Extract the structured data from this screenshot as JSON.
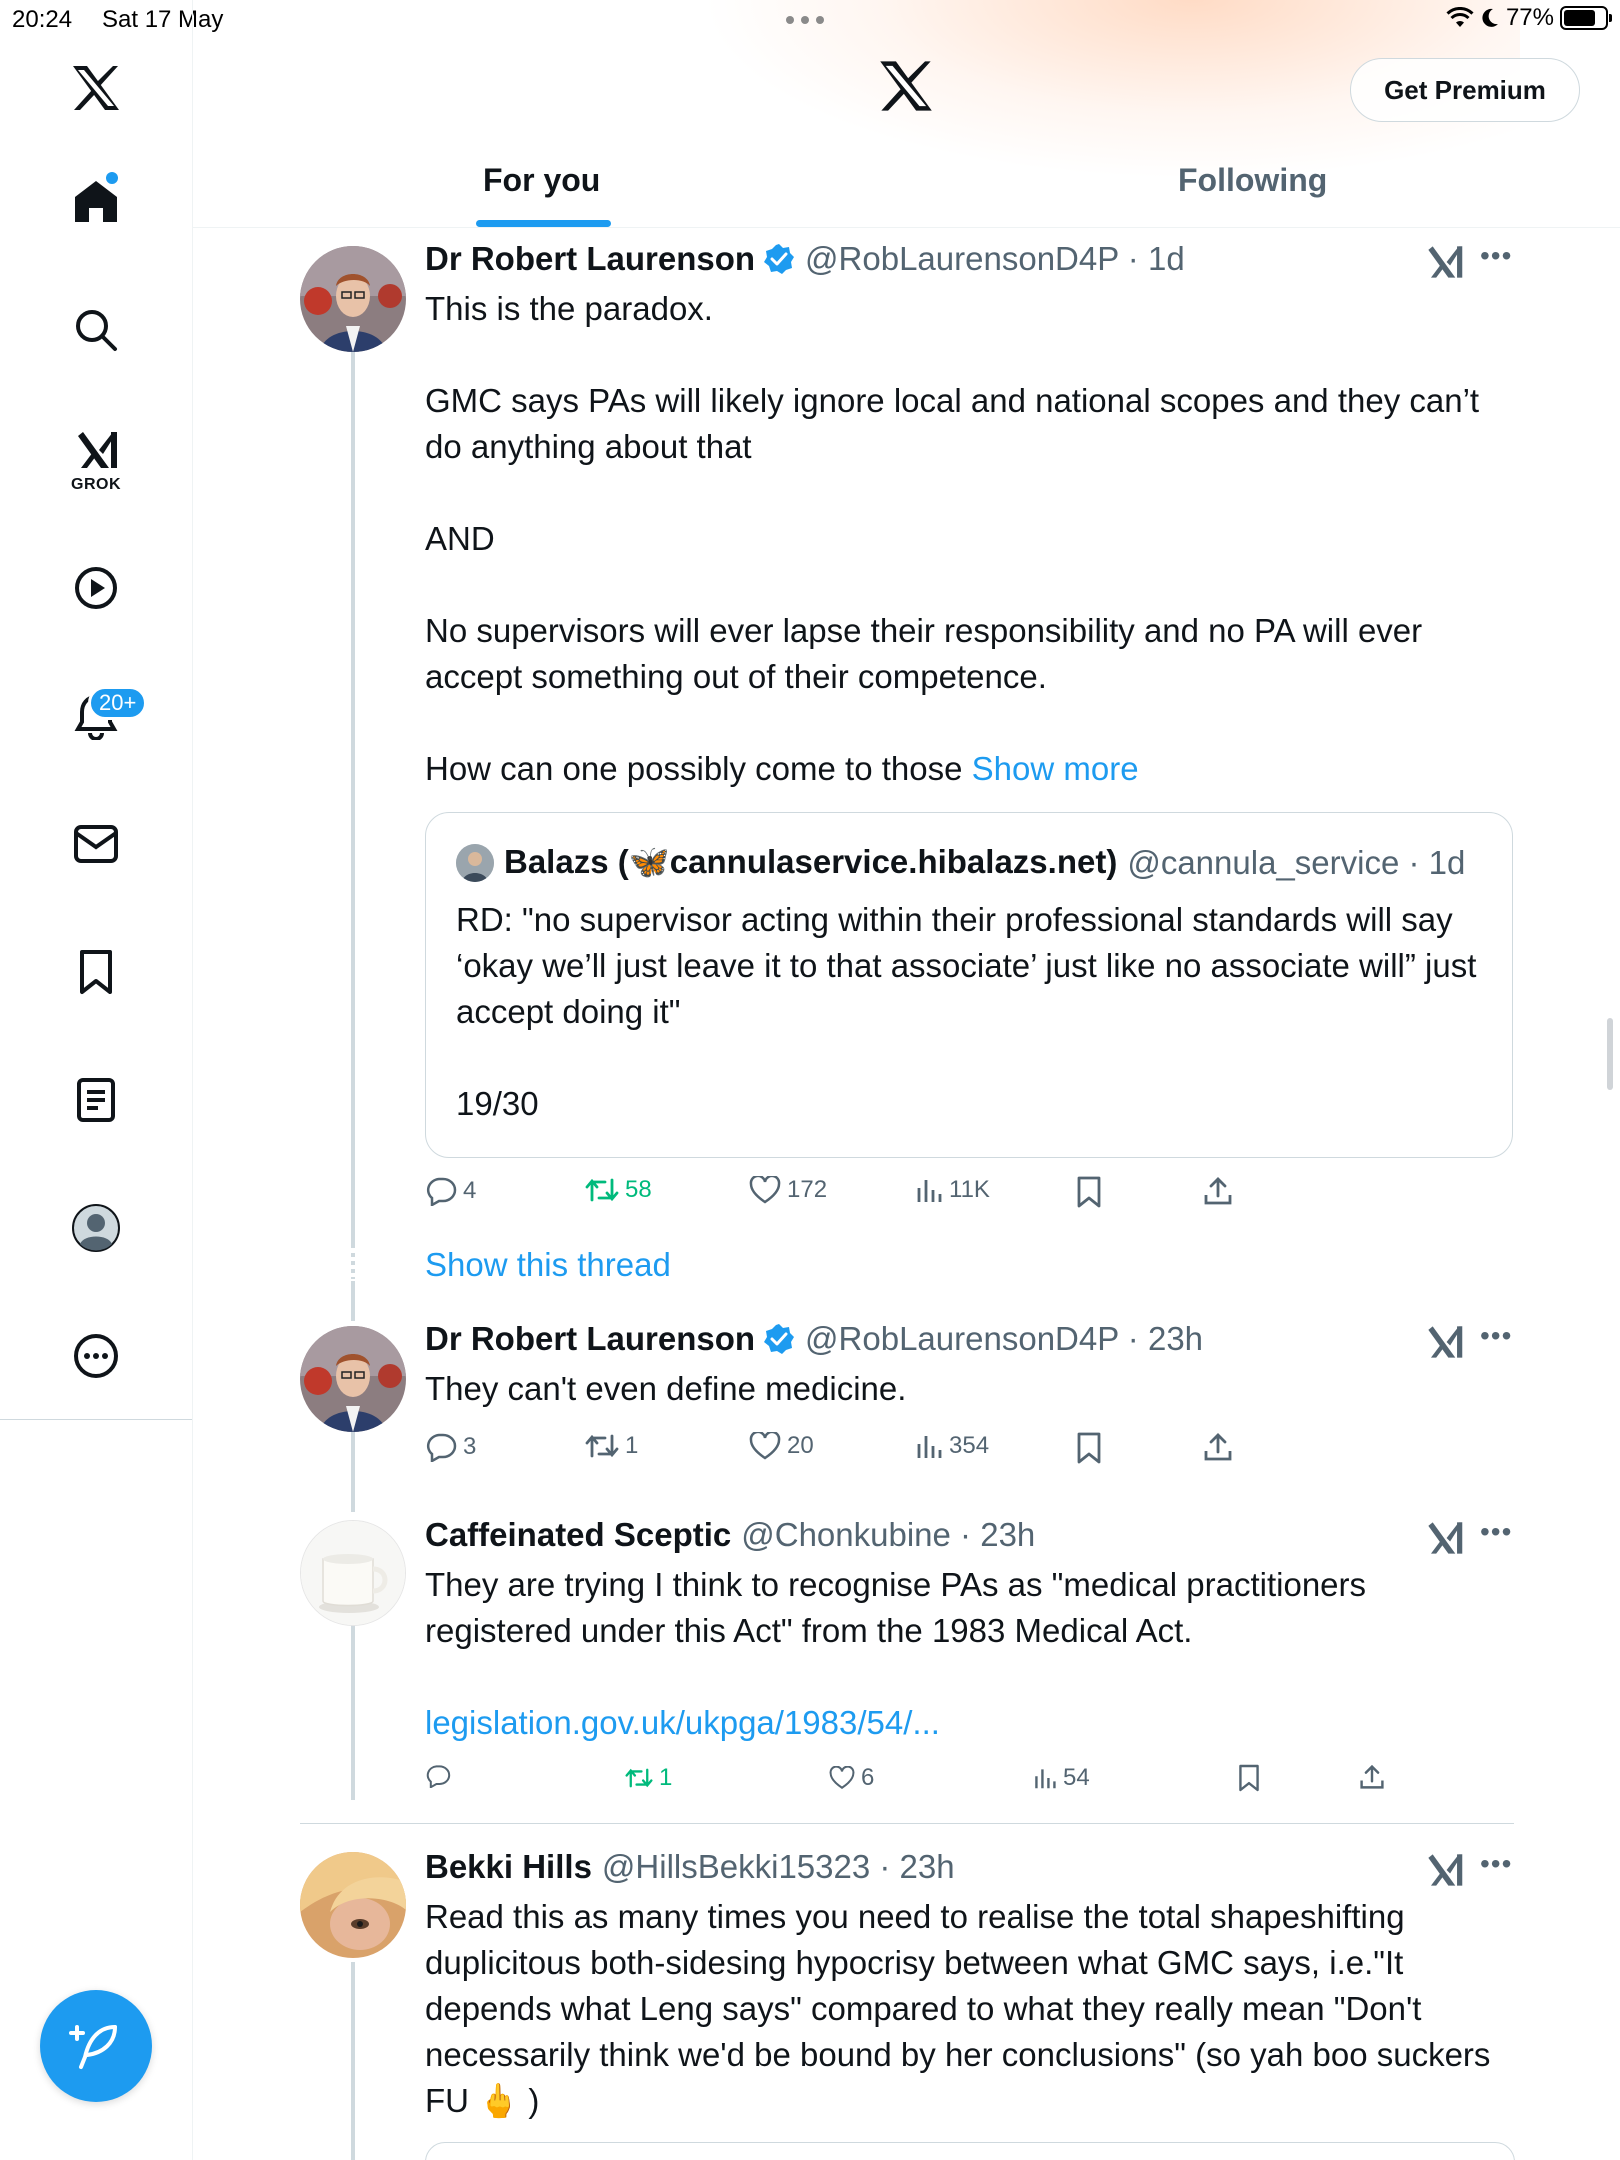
{
  "status_bar": {
    "time": "20:24",
    "date": "Sat 17 May",
    "battery": "77%",
    "battery_level": 0.77
  },
  "sidebar": {
    "items": [
      {
        "icon": "x-logo-icon"
      },
      {
        "icon": "home-icon",
        "has_dot": true
      },
      {
        "icon": "search-icon"
      },
      {
        "icon": "grok-icon",
        "label": "GROK"
      },
      {
        "icon": "video-play-icon"
      },
      {
        "icon": "notifications-bell-icon",
        "badge": "20+"
      },
      {
        "icon": "messages-mail-icon"
      },
      {
        "icon": "bookmarks-icon"
      },
      {
        "icon": "lists-icon"
      },
      {
        "icon": "profile-avatar-icon"
      },
      {
        "icon": "more-options-icon"
      }
    ],
    "compose_icon": "compose-feather-icon"
  },
  "header": {
    "logo_icon": "x-logo-icon",
    "premium_label": "Get Premium",
    "tabs": [
      {
        "label": "For you",
        "active": true
      },
      {
        "label": "Following",
        "active": false
      }
    ]
  },
  "colors": {
    "accent": "#1d9bf0",
    "text": "#0f1419",
    "muted": "#536471",
    "retweet_active": "#00ba7c",
    "border": "#cfd9de"
  },
  "tweets": [
    {
      "name": "Dr Robert Laurenson",
      "verified": true,
      "handle": "@RobLaurensonD4P · 1d",
      "text": "This is the paradox.\n\nGMC says PAs will likely ignore local and national scopes and they can’t do anything about that\n\nAND\n\nNo supervisors will ever lapse their responsibility and no PA will ever accept something out of their competence.\n\nHow can one possibly come to those ",
      "show_more": "Show more",
      "quote": {
        "name": "Balazs (🦋cannulaservice.hibalazs.net)",
        "handle": "@cannula_service · 1d",
        "text": "RD: \"no supervisor acting within their professional standards will say ‘okay we’ll just leave it to that associate’ just like no associate will” just accept doing it\"\n\n19/30"
      },
      "stats": {
        "replies": "4",
        "reposts": "58",
        "likes": "172",
        "views": "11K"
      },
      "show_thread": "Show this thread"
    },
    {
      "name": "Dr Robert Laurenson",
      "verified": true,
      "handle": "@RobLaurensonD4P · 23h",
      "text": "They can't even define medicine.",
      "stats": {
        "replies": "3",
        "reposts": "1",
        "likes": "20",
        "views": "354"
      }
    },
    {
      "name": "Caffeinated Sceptic",
      "verified": false,
      "handle": "@Chonkubine · 23h",
      "text": "They are trying I think to recognise PAs as \"medical practitioners registered under this Act\" from the 1983 Medical Act.\n\n",
      "link": "legislation.gov.uk/ukpga/1983/54/...",
      "stats": {
        "replies": "",
        "reposts": "1",
        "likes": "6",
        "views": "54"
      }
    },
    {
      "name": "Bekki Hills",
      "verified": false,
      "handle": "@HillsBekki15323 · 23h",
      "text": "Read this as many times you need to realise the total shapeshifting duplicitous both-sidesing hypocrisy between what GMC says, i.e.\"It depends what Leng says\" compared to what they really mean \"Don't necessarily think we'd be bound by her conclusions\" (so yah boo suckers FU 🖕 )"
    }
  ]
}
